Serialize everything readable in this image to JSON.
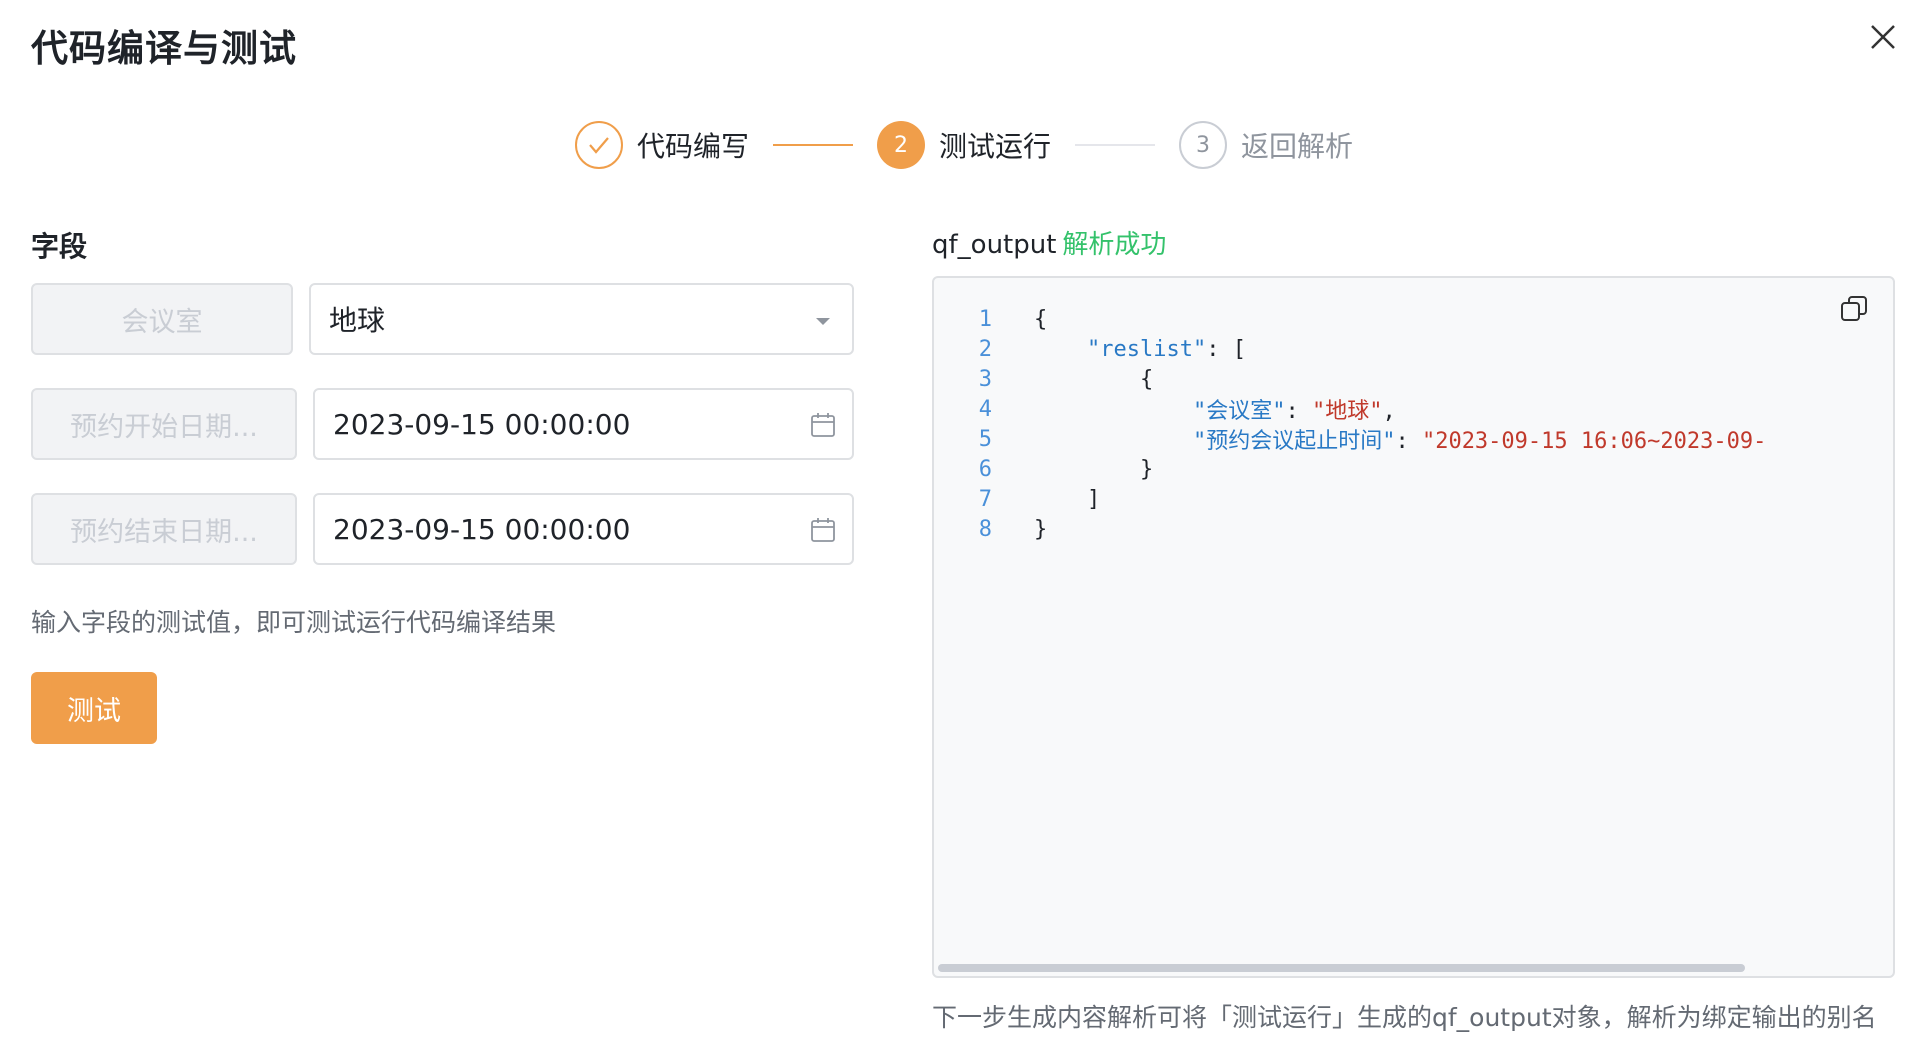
{
  "dialog": {
    "title": "代码编译与测试"
  },
  "steps": [
    {
      "number": "✓",
      "label": "代码编写",
      "state": "done"
    },
    {
      "number": "2",
      "label": "测试运行",
      "state": "active"
    },
    {
      "number": "3",
      "label": "返回解析",
      "state": "todo"
    }
  ],
  "fields": {
    "section_label": "字段",
    "rows": [
      {
        "key": "会议室",
        "value": "地球",
        "control": "dropdown"
      },
      {
        "key": "预约开始日期...",
        "value": "2023-09-15 00:00:00",
        "control": "datetime"
      },
      {
        "key": "预约结束日期...",
        "value": "2023-09-15 00:00:00",
        "control": "datetime"
      }
    ],
    "hint": "输入字段的测试值，即可测试运行代码编译结果",
    "test_button": "测试"
  },
  "output": {
    "name": "qf_output",
    "status": "解析成功",
    "lines": [
      {
        "n": "1",
        "parts": [
          {
            "t": "{",
            "c": "p"
          }
        ]
      },
      {
        "n": "2",
        "parts": [
          {
            "t": "    ",
            "c": "p"
          },
          {
            "t": "\"reslist\"",
            "c": "k"
          },
          {
            "t": ": [",
            "c": "p"
          }
        ]
      },
      {
        "n": "3",
        "parts": [
          {
            "t": "        {",
            "c": "p"
          }
        ]
      },
      {
        "n": "4",
        "parts": [
          {
            "t": "            ",
            "c": "p"
          },
          {
            "t": "\"会议室\"",
            "c": "k"
          },
          {
            "t": ": ",
            "c": "p"
          },
          {
            "t": "\"地球\"",
            "c": "s"
          },
          {
            "t": ",",
            "c": "p"
          }
        ]
      },
      {
        "n": "5",
        "parts": [
          {
            "t": "            ",
            "c": "p"
          },
          {
            "t": "\"预约会议起止时间\"",
            "c": "k"
          },
          {
            "t": ": ",
            "c": "p"
          },
          {
            "t": "\"2023-09-15 16:06~2023-09-",
            "c": "s"
          }
        ]
      },
      {
        "n": "6",
        "parts": [
          {
            "t": "        }",
            "c": "p"
          }
        ]
      },
      {
        "n": "7",
        "parts": [
          {
            "t": "    ]",
            "c": "p"
          }
        ]
      },
      {
        "n": "8",
        "parts": [
          {
            "t": "}",
            "c": "p"
          }
        ]
      }
    ],
    "footnote": "下一步生成内容解析可将「测试运行」生成的qf_output对象，解析为绑定输出的别名"
  },
  "colors": {
    "accent": "#f09e4a",
    "success": "#34c26b",
    "key": "#2979c5",
    "string": "#c0392b"
  }
}
